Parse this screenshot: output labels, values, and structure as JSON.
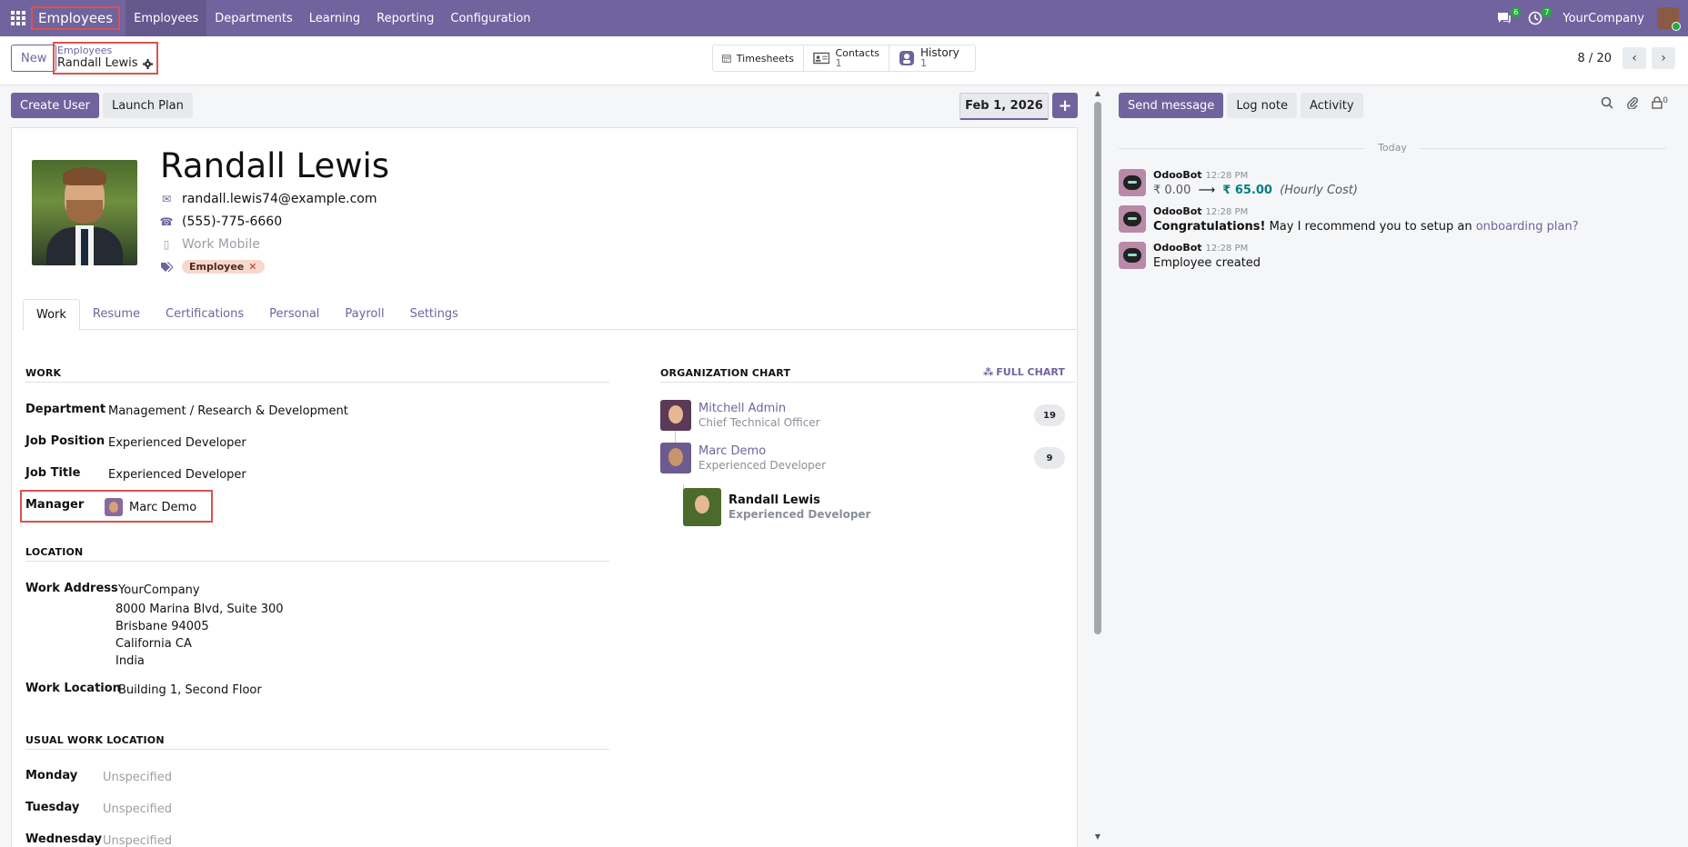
{
  "topbar": {
    "app_name": "Employees",
    "menu": [
      "Employees",
      "Departments",
      "Learning",
      "Reporting",
      "Configuration"
    ],
    "messages_count": "6",
    "activities_count": "7",
    "company": "YourCompany"
  },
  "control": {
    "new_label": "New",
    "breadcrumb_parent": "Employees",
    "breadcrumb_current": "Randall Lewis",
    "smart_buttons": [
      {
        "label": "Timesheets",
        "icon": "calendar-icon"
      },
      {
        "label": "Contacts",
        "value": "1",
        "icon": "contact-card-icon"
      },
      {
        "label": "History",
        "value": "1",
        "icon": "history-icon"
      }
    ],
    "pager": "8 / 20"
  },
  "actions": {
    "create_user": "Create User",
    "launch_plan": "Launch Plan",
    "date": "Feb 1, 2026"
  },
  "employee": {
    "name": "Randall Lewis",
    "email": "randall.lewis74@example.com",
    "phone": "(555)-775-6660",
    "mobile_placeholder": "Work Mobile",
    "tag": "Employee"
  },
  "tabs": [
    "Work",
    "Resume",
    "Certifications",
    "Personal",
    "Payroll",
    "Settings"
  ],
  "work": {
    "title": "WORK",
    "department_label": "Department",
    "department": "Management / Research & Development",
    "job_position_label": "Job Position",
    "job_position": "Experienced Developer",
    "job_title_label": "Job Title",
    "job_title": "Experienced Developer",
    "manager_label": "Manager",
    "manager": "Marc Demo"
  },
  "location": {
    "title": "LOCATION",
    "work_address_label": "Work Address",
    "address_lines": [
      "YourCompany",
      "8000 Marina Blvd, Suite 300",
      "Brisbane 94005",
      "California CA",
      "India"
    ],
    "work_location_label": "Work Location",
    "work_location": "Building 1, Second Floor"
  },
  "usual": {
    "title": "USUAL WORK LOCATION",
    "days": [
      {
        "day": "Monday",
        "value": "Unspecified"
      },
      {
        "day": "Tuesday",
        "value": "Unspecified"
      },
      {
        "day": "Wednesday",
        "value": "Unspecified"
      }
    ]
  },
  "org": {
    "title": "ORGANIZATION CHART",
    "full_chart": "FULL CHART",
    "people": [
      {
        "name": "Mitchell Admin",
        "job": "Chief Technical Officer",
        "count": "19"
      },
      {
        "name": "Marc Demo",
        "job": "Experienced Developer",
        "count": "9"
      },
      {
        "name": "Randall Lewis",
        "job": "Experienced Developer"
      }
    ]
  },
  "chatter": {
    "send_message": "Send message",
    "log_note": "Log note",
    "activity": "Activity",
    "follower_count": "0",
    "today": "Today",
    "messages": [
      {
        "author": "OdooBot",
        "time": "12:28 PM",
        "old": "₹ 0.00",
        "new": "₹ 65.00",
        "field": "(Hourly Cost)"
      },
      {
        "author": "OdooBot",
        "time": "12:28 PM",
        "strong": "Congratulations!",
        "text": "May I recommend you to setup an",
        "link": "onboarding plan?"
      },
      {
        "author": "OdooBot",
        "time": "12:28 PM",
        "text": "Employee created"
      }
    ]
  }
}
